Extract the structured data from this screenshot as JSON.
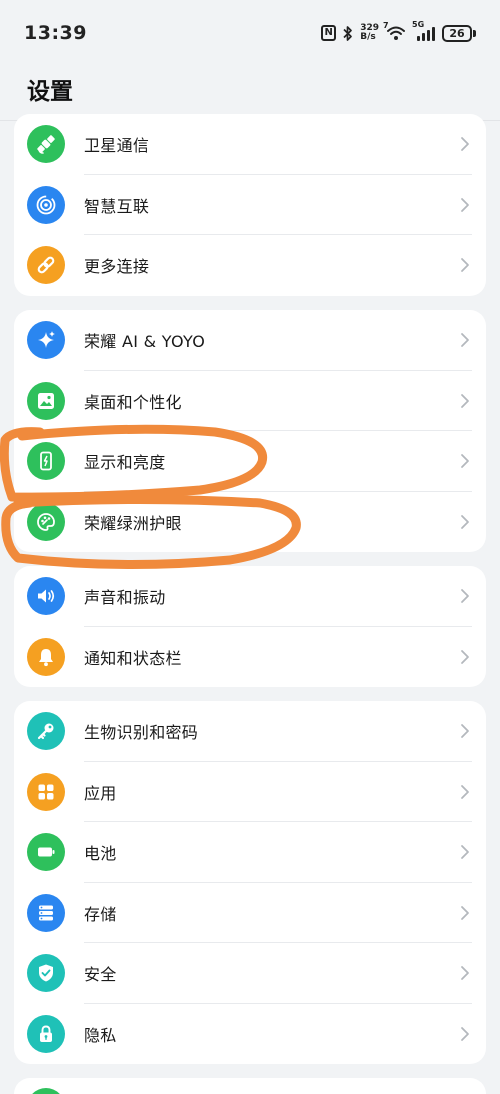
{
  "status_bar": {
    "time": "13:39",
    "nfc": "N",
    "speed_value": "329",
    "speed_unit": "B/s",
    "wifi_label": "7",
    "signal_label": "5G",
    "battery": "26"
  },
  "header": {
    "title": "设置"
  },
  "groups": [
    {
      "items": [
        {
          "label": "卫星通信",
          "icon": "satellite-icon",
          "color": "#2ec05c"
        },
        {
          "label": "智慧互联",
          "icon": "link-rings-icon",
          "color": "#2a86f0"
        },
        {
          "label": "更多连接",
          "icon": "chain-link-icon",
          "color": "#f5a021"
        }
      ]
    },
    {
      "items": [
        {
          "label": "荣耀 AI & YOYO",
          "icon": "sparkle-icon",
          "color": "#2a86f0"
        },
        {
          "label": "桌面和个性化",
          "icon": "picture-icon",
          "color": "#2ec05c"
        },
        {
          "label": "显示和亮度",
          "icon": "phone-display-icon",
          "color": "#2ec05c"
        },
        {
          "label": "荣耀绿洲护眼",
          "icon": "palette-icon",
          "color": "#2ec05c"
        }
      ]
    },
    {
      "items": [
        {
          "label": "声音和振动",
          "icon": "speaker-icon",
          "color": "#2a86f0"
        },
        {
          "label": "通知和状态栏",
          "icon": "bell-icon",
          "color": "#f5a021"
        }
      ]
    },
    {
      "items": [
        {
          "label": "生物识别和密码",
          "icon": "key-icon",
          "color": "#1fc1b7"
        },
        {
          "label": "应用",
          "icon": "apps-grid-icon",
          "color": "#f5a021"
        },
        {
          "label": "电池",
          "icon": "battery-icon",
          "color": "#2ec05c"
        },
        {
          "label": "存储",
          "icon": "storage-icon",
          "color": "#2a86f0"
        },
        {
          "label": "安全",
          "icon": "shield-check-icon",
          "color": "#1fc1b7"
        },
        {
          "label": "隐私",
          "icon": "lock-icon",
          "color": "#1fc1b7"
        }
      ]
    }
  ],
  "annotation": {
    "color": "#f08a3c"
  }
}
